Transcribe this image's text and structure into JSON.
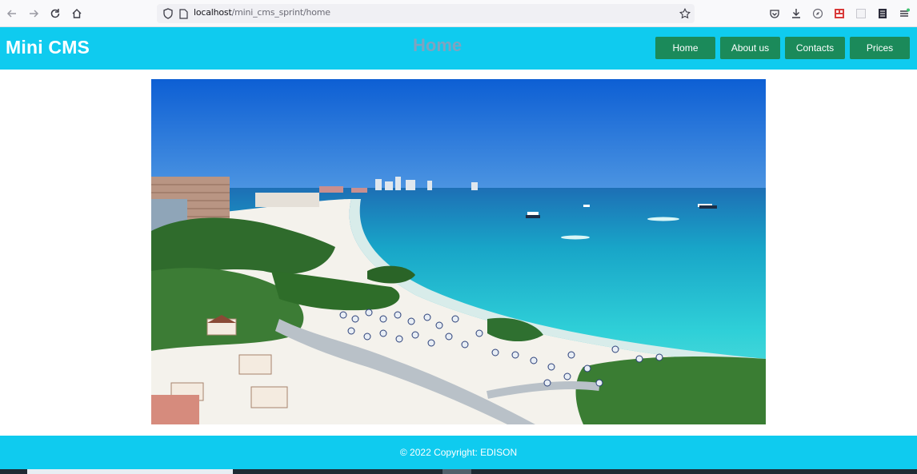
{
  "browser": {
    "url_host": "localhost",
    "url_path": "/mini_cms_sprint/home",
    "icons": [
      "back-arrow-icon",
      "forward-arrow-icon",
      "reload-icon",
      "home-icon",
      "shield-icon",
      "page-icon",
      "star-icon",
      "pocket-icon",
      "download-icon",
      "compass-icon",
      "extension-icon",
      "blank-extension-icon",
      "notes-icon",
      "menu-icon"
    ]
  },
  "header": {
    "brand": "Mini CMS",
    "page_title": "Home",
    "nav": [
      {
        "label": "Home"
      },
      {
        "label": "About us"
      },
      {
        "label": "Contacts"
      },
      {
        "label": "Prices"
      }
    ],
    "colors": {
      "bar": "#0fcbef",
      "button": "#1b8a5a",
      "heading": "#7fa3c0"
    }
  },
  "hero": {
    "image": "beach-resort-photo"
  },
  "footer": {
    "copyright": "© 2022 Copyright: EDISON"
  }
}
